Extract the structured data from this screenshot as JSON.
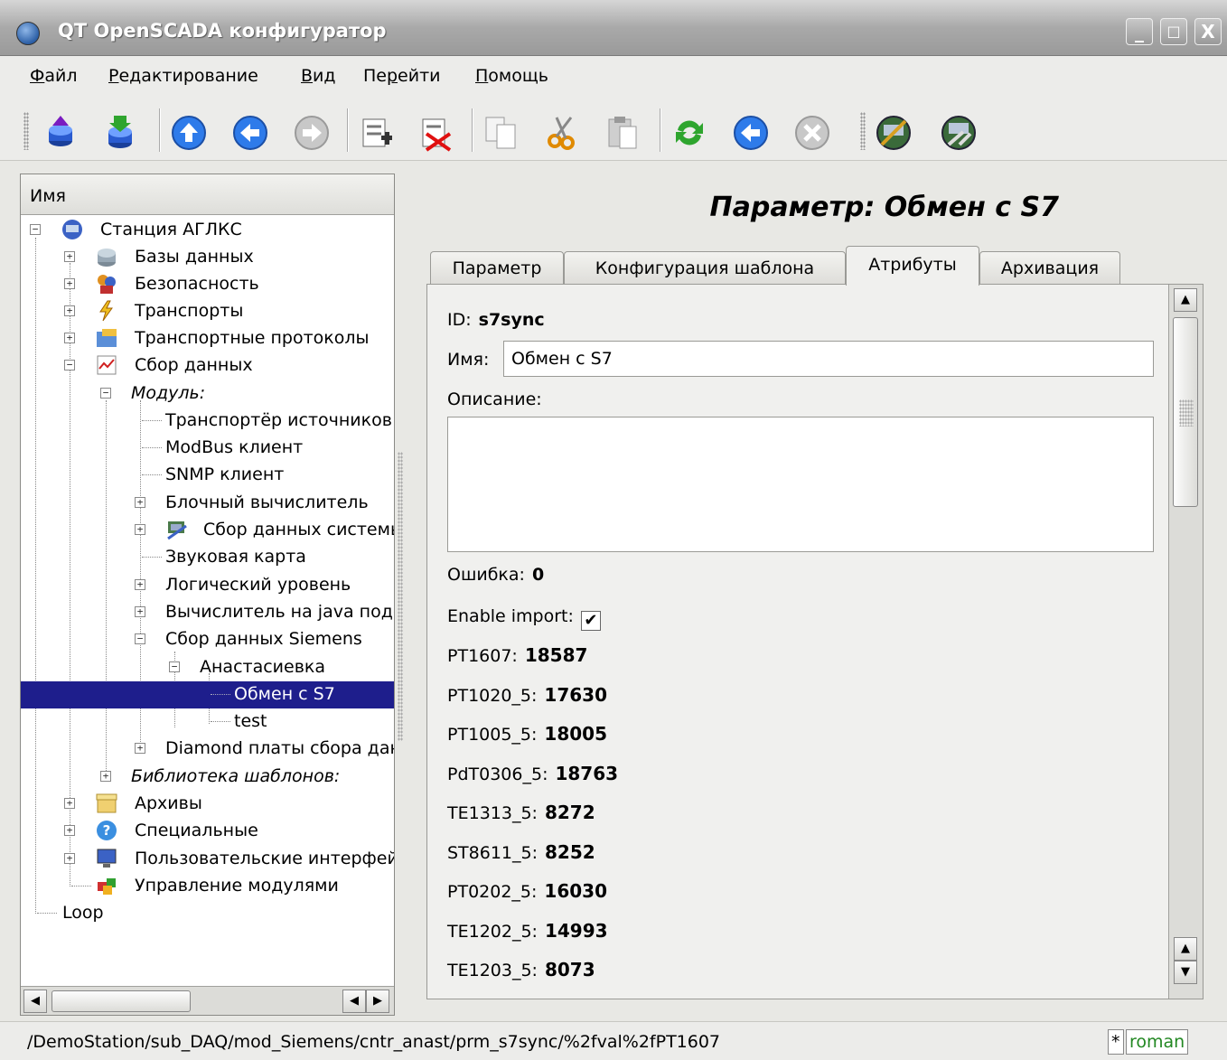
{
  "window": {
    "title": "QT OpenSCADA конфигуратор",
    "buttons": [
      "_",
      "□",
      "X"
    ]
  },
  "menu": [
    "Файл",
    "Редактирование",
    "Вид",
    "Перейти",
    "Помощь"
  ],
  "toolbar": [
    "db-load-icon",
    "db-save-icon",
    "up-icon",
    "back-icon",
    "forward-icon",
    "add-item-icon",
    "delete-item-icon",
    "copy-icon",
    "cut-icon",
    "paste-icon",
    "refresh-icon",
    "start-icon",
    "stop-icon",
    "station-config-icon",
    "station-tools-icon"
  ],
  "tree": {
    "header": "Имя",
    "rows": [
      {
        "label": "Станция АГЛКС",
        "italic": false
      },
      {
        "label": "Базы данных",
        "italic": false
      },
      {
        "label": "Безопасность",
        "italic": false
      },
      {
        "label": "Транспорты",
        "italic": false
      },
      {
        "label": "Транспортные протоколы",
        "italic": false
      },
      {
        "label": "Сбор данных",
        "italic": false
      },
      {
        "label": "Модуль:",
        "italic": true
      },
      {
        "label": "Транспортёр источников",
        "italic": false
      },
      {
        "label": "ModBus клиент",
        "italic": false
      },
      {
        "label": "SNMP клиент",
        "italic": false
      },
      {
        "label": "Блочный вычислитель",
        "italic": false
      },
      {
        "label": "Сбор данных системы",
        "italic": false
      },
      {
        "label": "Звуковая карта",
        "italic": false
      },
      {
        "label": "Логический уровень",
        "italic": false
      },
      {
        "label": "Вычислитель на java подобном",
        "italic": false
      },
      {
        "label": "Сбор данных Siemens",
        "italic": false
      },
      {
        "label": "Анастасиевка",
        "italic": false
      },
      {
        "label": "Обмен с S7",
        "italic": false
      },
      {
        "label": "test",
        "italic": false
      },
      {
        "label": "Diamond платы сбора данных",
        "italic": false
      },
      {
        "label": "Библиотека шаблонов:",
        "italic": true
      },
      {
        "label": "Архивы",
        "italic": false
      },
      {
        "label": "Специальные",
        "italic": false
      },
      {
        "label": "Пользовательские интерфейсы",
        "italic": false
      },
      {
        "label": "Управление модулями",
        "italic": false
      },
      {
        "label": "Loop",
        "italic": false
      }
    ]
  },
  "page": {
    "title": "Параметр: Обмен с S7",
    "tabs": [
      "Параметр",
      "Конфигурация шаблона",
      "Атрибуты",
      "Архивация"
    ],
    "active_tab": "Атрибуты",
    "id_label": "ID:",
    "id_value": "s7sync",
    "name_label": "Имя:",
    "name_value": "Обмен с S7",
    "desc_label": "Описание:",
    "error_label": "Ошибка:",
    "error_value": "0",
    "enable_import_label": "Enable import:",
    "enable_import_checked": "✔",
    "attributes": [
      {
        "name": "PT1607:",
        "value": "18587"
      },
      {
        "name": "PT1020_5:",
        "value": "17630"
      },
      {
        "name": "PT1005_5:",
        "value": "18005"
      },
      {
        "name": "PdT0306_5:",
        "value": "18763"
      },
      {
        "name": "TE1313_5:",
        "value": "8272"
      },
      {
        "name": "ST8611_5:",
        "value": "8252"
      },
      {
        "name": "PT0202_5:",
        "value": "16030"
      },
      {
        "name": "TE1202_5:",
        "value": "14993"
      },
      {
        "name": "TE1203_5:",
        "value": "8073"
      }
    ]
  },
  "status": {
    "path": "/DemoStation/sub_DAQ/mod_Siemens/cntr_anast/prm_s7sync/%2fval%2fPT1607",
    "modified": "*",
    "user": "roman"
  }
}
